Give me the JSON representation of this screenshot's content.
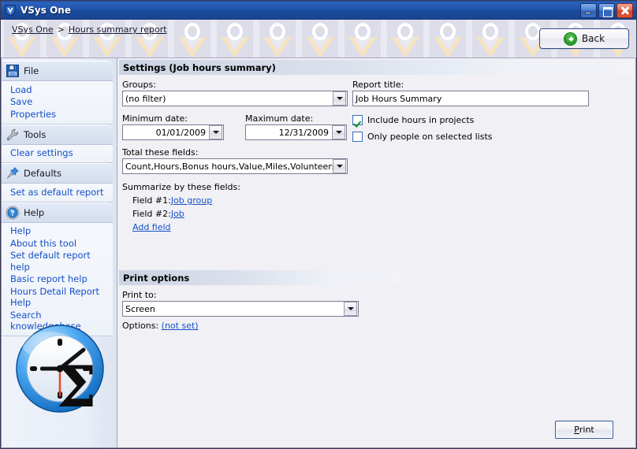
{
  "window": {
    "title": "VSys One",
    "app_icon": "vsys-shield-icon",
    "buttons": {
      "minimize": "minimize-icon",
      "maximize": "maximize-icon",
      "close": "close-icon"
    }
  },
  "banner": {
    "breadcrumb": [
      {
        "label": "VSys One",
        "link": true
      },
      {
        "label": ">",
        "link": false
      },
      {
        "label": "Hours summary report",
        "link": true
      }
    ],
    "back_button": {
      "label": "Back",
      "icon": "back-arrow-icon"
    }
  },
  "sidebar": {
    "sections": [
      {
        "title": "File",
        "icon": "floppy-disk-icon",
        "links": [
          "Load",
          "Save",
          "Properties"
        ]
      },
      {
        "title": "Tools",
        "icon": "wrench-icon",
        "links": [
          "Clear settings"
        ]
      },
      {
        "title": "Defaults",
        "icon": "pushpin-icon",
        "links": [
          "Set as default report"
        ]
      },
      {
        "title": "Help",
        "icon": "question-circle-icon",
        "links": [
          "Help",
          "About this tool",
          "Set default report help",
          "Basic report help",
          "Hours Detail Report Help",
          "Search knowledgebase"
        ]
      }
    ],
    "logo": "clock-sigma-logo"
  },
  "settings": {
    "panel_title": "Settings (Job hours summary)",
    "groups": {
      "label": "Groups:",
      "value": "(no filter)"
    },
    "min_date": {
      "label": "Minimum date:",
      "value": "01/01/2009"
    },
    "max_date": {
      "label": "Maximum date:",
      "value": "12/31/2009"
    },
    "total_fields": {
      "label": "Total these fields:",
      "value": "Count,Hours,Bonus hours,Value,Miles,Volunteers,Full-"
    },
    "report_title": {
      "label": "Report title:",
      "value": "Job Hours Summary"
    },
    "checkboxes": [
      {
        "label": "Include hours in projects",
        "checked": true
      },
      {
        "label": "Only people on selected lists",
        "checked": false
      }
    ],
    "summarize": {
      "label": "Summarize by these fields:",
      "fields": [
        {
          "prefix": "Field #1:",
          "value": "Job group"
        },
        {
          "prefix": "Field #2:",
          "value": "Job"
        }
      ],
      "add_link": "Add field"
    }
  },
  "print_options": {
    "panel_title": "Print options",
    "print_to": {
      "label": "Print to:",
      "value": "Screen"
    },
    "options": {
      "label": "Options:",
      "value": "(not set)"
    },
    "print_button": {
      "prefix": "P",
      "rest": "rint"
    }
  },
  "colors": {
    "titlebar_blue": "#2055ad",
    "link_blue": "#1550c8",
    "check_green": "#0a8a28",
    "content_bg": "#f0f0f5",
    "close_red": "#cf4428"
  }
}
